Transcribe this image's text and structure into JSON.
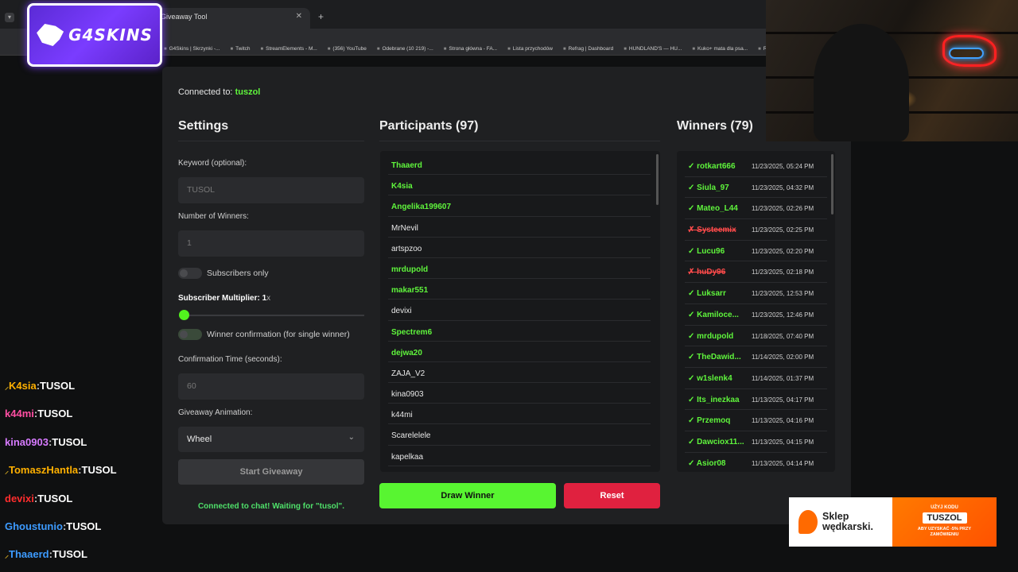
{
  "browser": {
    "tab_title": "Giveaway Tool",
    "new_tab": "+",
    "bookmarks": [
      "G4Skins | Skrzynki -...",
      "Twitch",
      "StreamElements - M...",
      "(356) YouTube",
      "Odebrane (10 219) -...",
      "Strona główna - FA...",
      "Lista przychodów",
      "Refrag | Dashboard",
      "HUNDLAND'S — HU...",
      "Kuko+ mata dla psa...",
      "Reborn • The Ho"
    ]
  },
  "logo": {
    "text": "G4SKINS"
  },
  "chat": [
    {
      "user": "K4sia",
      "color": "#ffb000",
      "badge": true,
      "msg": "TUSOL"
    },
    {
      "user": "k44mi",
      "color": "#ff4fa3",
      "badge": false,
      "msg": "TUSOL"
    },
    {
      "user": "kina0903",
      "color": "#d77bff",
      "badge": false,
      "msg": "TUSOL"
    },
    {
      "user": "TomaszHantla",
      "color": "#ffb000",
      "badge": true,
      "msg": "TUSOL"
    },
    {
      "user": "devixi",
      "color": "#ff2d2d",
      "badge": false,
      "msg": "TUSOL"
    },
    {
      "user": "Ghoustunio",
      "color": "#3d9bff",
      "badge": false,
      "msg": "TUSOL"
    },
    {
      "user": "Thaaerd",
      "color": "#3d9bff",
      "badge": true,
      "msg": "TUSOL"
    }
  ],
  "app": {
    "connected_label": "Connected to:",
    "connected_channel": "tuszol",
    "settings": {
      "title": "Settings",
      "keyword_label": "Keyword (optional):",
      "keyword_placeholder": "TUSOL",
      "winners_label": "Number of Winners:",
      "winners_value": "1",
      "subs_only_label": "Subscribers only",
      "multiplier_label": "Subscriber Multiplier:",
      "multiplier_value": "1",
      "multiplier_unit": "x",
      "confirmation_label": "Winner confirmation (for single winner)",
      "confirm_time_label": "Confirmation Time (seconds):",
      "confirm_time_value": "60",
      "animation_label": "Giveaway Animation:",
      "animation_value": "Wheel",
      "start_button": "Start Giveaway",
      "status": "Connected to chat! Waiting for \"tusol\"."
    },
    "participants": {
      "title": "Participants (97)",
      "items": [
        {
          "name": "Thaaerd",
          "sub": true
        },
        {
          "name": "K4sia",
          "sub": true
        },
        {
          "name": "Angelika199607",
          "sub": true
        },
        {
          "name": "MrNevil",
          "sub": false
        },
        {
          "name": "artspzoo",
          "sub": false
        },
        {
          "name": "mrdupold",
          "sub": true
        },
        {
          "name": "makar551",
          "sub": true
        },
        {
          "name": "devixi",
          "sub": false
        },
        {
          "name": "Spectrem6",
          "sub": true
        },
        {
          "name": "dejwa20",
          "sub": true
        },
        {
          "name": "ZAJA_V2",
          "sub": false
        },
        {
          "name": "kina0903",
          "sub": false
        },
        {
          "name": "k44mi",
          "sub": false
        },
        {
          "name": "Scarelelele",
          "sub": false
        },
        {
          "name": "kapelkaa",
          "sub": false
        }
      ],
      "draw_button": "Draw Winner",
      "reset_button": "Reset"
    },
    "winners": {
      "title": "Winners (79)",
      "items": [
        {
          "name": "✓ rotkart666",
          "date": "11/23/2025, 05:24 PM",
          "rejected": false
        },
        {
          "name": "✓ Siula_97",
          "date": "11/23/2025, 04:32 PM",
          "rejected": false
        },
        {
          "name": "✓ Mateo_L44",
          "date": "11/23/2025, 02:26 PM",
          "rejected": false
        },
        {
          "name": "✗ Systeemix",
          "date": "11/23/2025, 02:25 PM",
          "rejected": true
        },
        {
          "name": "✓ Lucu96",
          "date": "11/23/2025, 02:20 PM",
          "rejected": false
        },
        {
          "name": "✗ huDy96",
          "date": "11/23/2025, 02:18 PM",
          "rejected": true
        },
        {
          "name": "✓ Luksarr",
          "date": "11/23/2025, 12:53 PM",
          "rejected": false
        },
        {
          "name": "✓ Kamiloce...",
          "date": "11/23/2025, 12:46 PM",
          "rejected": false
        },
        {
          "name": "✓ mrdupold",
          "date": "11/18/2025, 07:40 PM",
          "rejected": false
        },
        {
          "name": "✓ TheDawid...",
          "date": "11/14/2025, 02:00 PM",
          "rejected": false
        },
        {
          "name": "✓ w1slenk4",
          "date": "11/14/2025, 01:37 PM",
          "rejected": false
        },
        {
          "name": "✓ Its_inezkaa",
          "date": "11/13/2025, 04:17 PM",
          "rejected": false
        },
        {
          "name": "✓ Przemoq",
          "date": "11/13/2025, 04:16 PM",
          "rejected": false
        },
        {
          "name": "✓ Dawciox11...",
          "date": "11/13/2025, 04:15 PM",
          "rejected": false
        },
        {
          "name": "✓ Asior08",
          "date": "11/13/2025, 04:14 PM",
          "rejected": false
        }
      ]
    }
  },
  "ad": {
    "brand": "Sklep\nwędkarski.",
    "line1": "UŻYJ KODU",
    "code": "TUSZOL",
    "line3": "ABY UZYSKAĆ -5% PRZY\nZAMÓWIENIU"
  }
}
